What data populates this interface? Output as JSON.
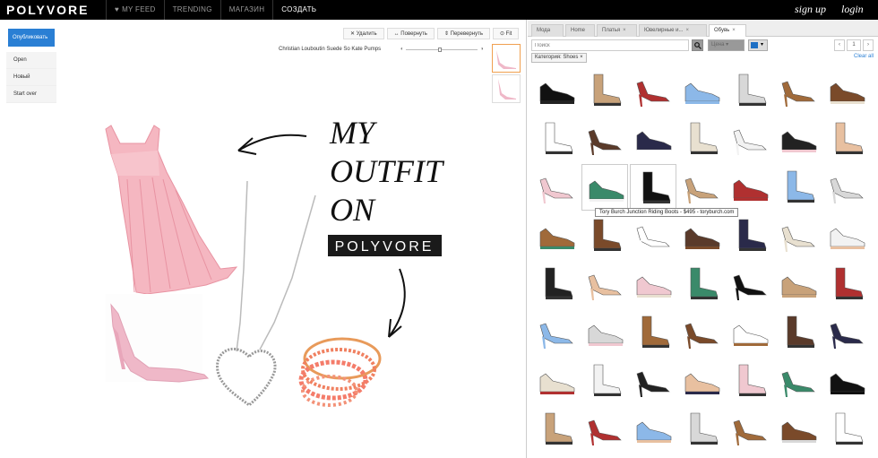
{
  "header": {
    "logo": "POLYVORE",
    "nav": [
      {
        "label": "MY FEED",
        "active": false,
        "icon": "heart-icon"
      },
      {
        "label": "TRENDING",
        "active": false
      },
      {
        "label": "МАГАЗИН",
        "active": false
      },
      {
        "label": "СОЗДАТЬ",
        "active": true
      }
    ],
    "signup": "sign up",
    "login": "login"
  },
  "editor": {
    "publish": "Опубликовать",
    "menu": [
      "Open",
      "Новый",
      "Start over"
    ],
    "toolbar": [
      "Удалить",
      "Повернуть",
      "Перевернуть",
      "Fit"
    ],
    "selected_item": "Christian Louboutin Suede So Kate Pumps"
  },
  "collage": {
    "text_line1": "MY",
    "text_line2": "OUTFIT",
    "text_line3": "ON",
    "badge": "POLYVORE"
  },
  "panel": {
    "tabs": [
      {
        "label": "Мода",
        "close": false
      },
      {
        "label": "Home",
        "close": false
      },
      {
        "label": "Платья",
        "close": true
      },
      {
        "label": "Ювелирные и...",
        "close": true
      },
      {
        "label": "Обувь",
        "close": true,
        "active": true
      }
    ],
    "search_placeholder": "Поиск",
    "price_label": "Цена",
    "page": "1",
    "filter_chip": "Категория: Shoes",
    "clear_all": "Clear all",
    "tooltip": "Tory Burch Junction Riding Boots - $495 - toryburch.com"
  },
  "colors": {
    "accent": "#2a7fd4",
    "topbar": "#000000"
  }
}
